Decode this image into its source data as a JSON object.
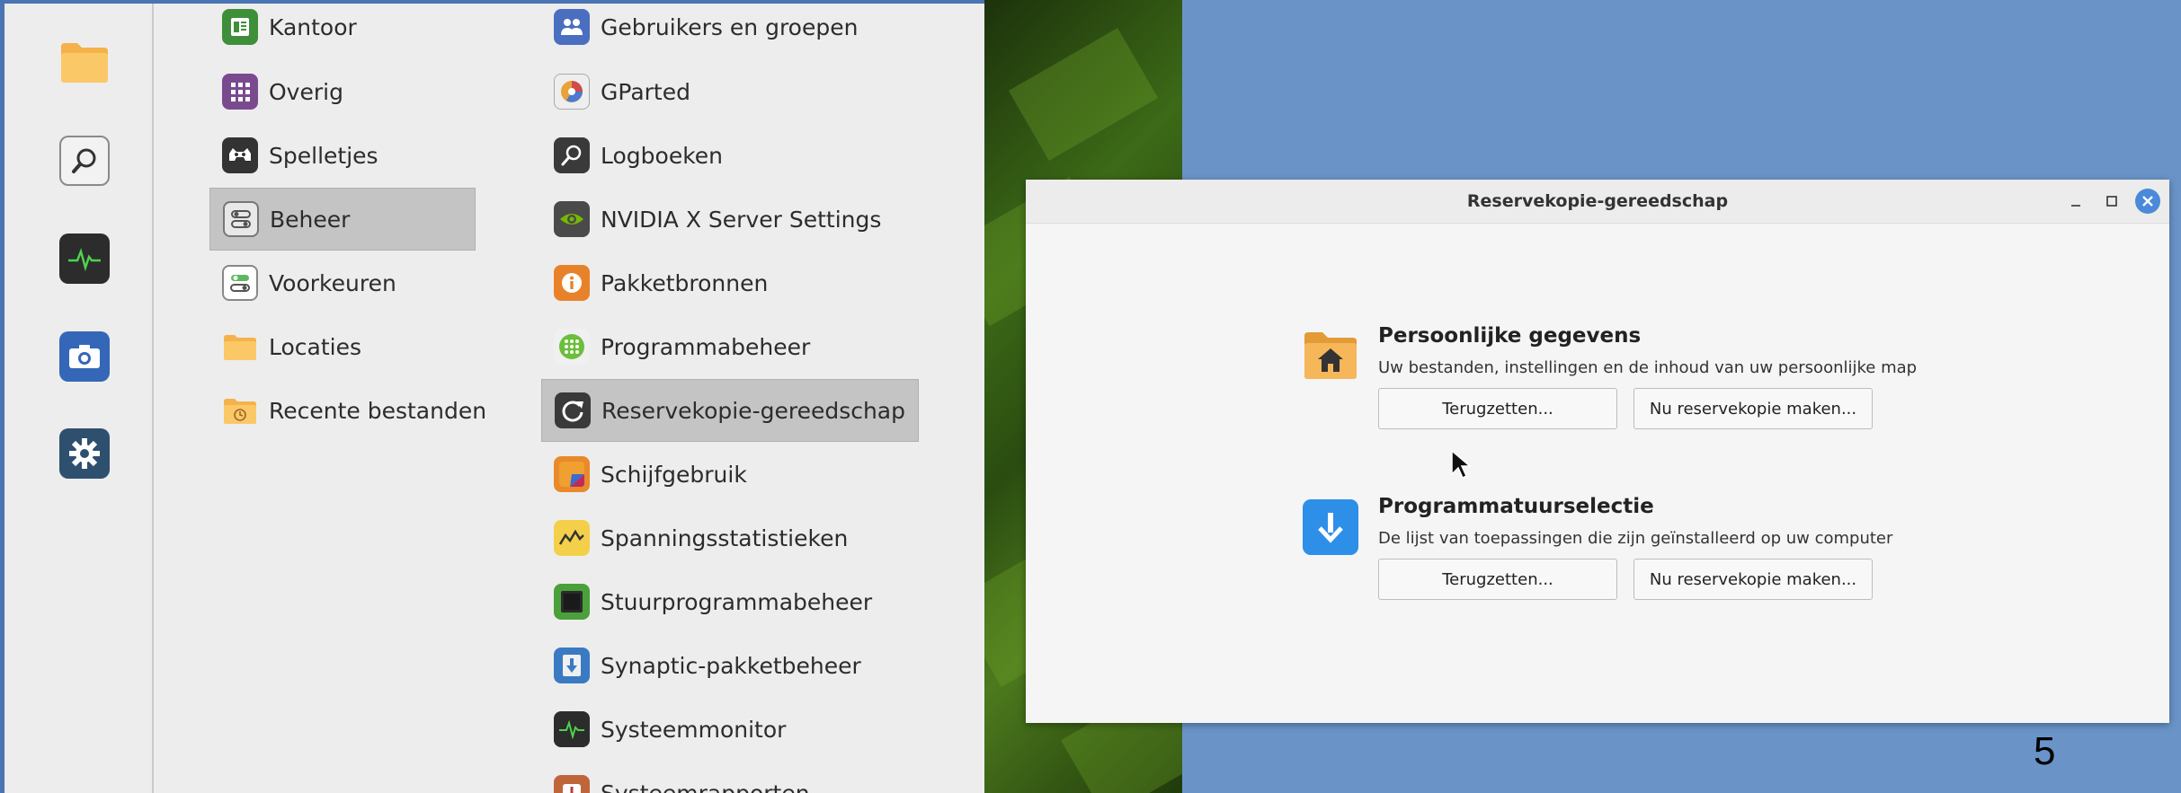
{
  "menu": {
    "categories": [
      {
        "label": "Kantoor",
        "icon": "office-icon"
      },
      {
        "label": "Overig",
        "icon": "grid-icon"
      },
      {
        "label": "Spelletjes",
        "icon": "gamepad-icon"
      },
      {
        "label": "Beheer",
        "icon": "toggle-icon",
        "selected": true
      },
      {
        "label": "Voorkeuren",
        "icon": "toggle-icon"
      },
      {
        "label": "Locaties",
        "icon": "folder-icon"
      },
      {
        "label": "Recente bestanden",
        "icon": "recent-folder-icon"
      }
    ],
    "apps": [
      {
        "label": "Gebruikers en groepen",
        "icon": "users-icon"
      },
      {
        "label": "GParted",
        "icon": "gparted-icon"
      },
      {
        "label": "Logboeken",
        "icon": "logs-icon"
      },
      {
        "label": "NVIDIA X Server Settings",
        "icon": "nvidia-icon"
      },
      {
        "label": "Pakketbronnen",
        "icon": "info-icon"
      },
      {
        "label": "Programmabeheer",
        "icon": "software-manager-icon"
      },
      {
        "label": "Reservekopie-gereedschap",
        "icon": "backup-icon",
        "selected": true
      },
      {
        "label": "Schijfgebruik",
        "icon": "disk-usage-icon"
      },
      {
        "label": "Spanningsstatistieken",
        "icon": "power-stats-icon"
      },
      {
        "label": "Stuurprogrammabeheer",
        "icon": "driver-icon"
      },
      {
        "label": "Synaptic-pakketbeheer",
        "icon": "synaptic-icon"
      },
      {
        "label": "Systeemmonitor",
        "icon": "system-monitor-icon"
      },
      {
        "label": "Systeemrapporten",
        "icon": "system-reports-icon"
      }
    ]
  },
  "dialog": {
    "title": "Reservekopie-gereedschap",
    "personal": {
      "title": "Persoonlijke gegevens",
      "description": "Uw bestanden, instellingen en de inhoud van uw persoonlijke map",
      "restore_label": "Terugzetten...",
      "backup_label": "Nu reservekopie maken..."
    },
    "software": {
      "title": "Programmatuurselectie",
      "description": "De lijst van toepassingen die zijn geïnstalleerd op uw computer",
      "restore_label": "Terugzetten...",
      "backup_label": "Nu reservekopie maken..."
    }
  },
  "page_number": "5",
  "colors": {
    "desktop": "#6a94c8",
    "menu_bg": "#ededed",
    "selection": "#c4c4c4",
    "close_button": "#4a8ad8"
  }
}
